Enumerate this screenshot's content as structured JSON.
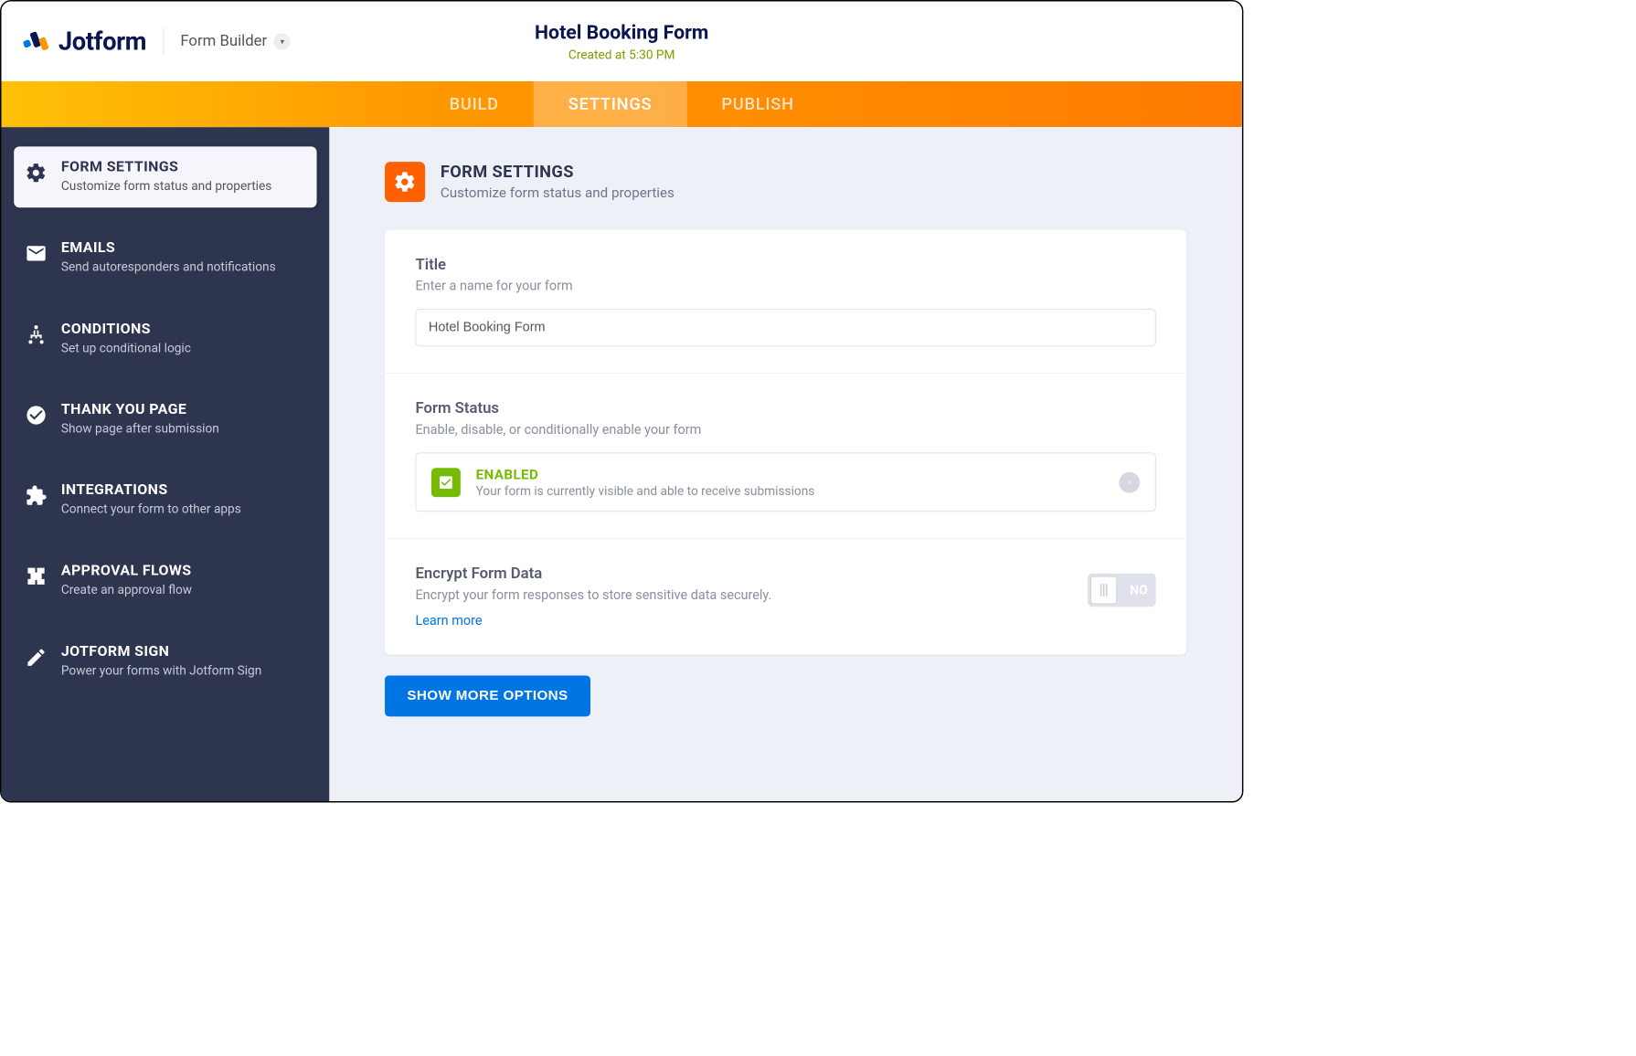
{
  "header": {
    "brand": "Jotform",
    "builder_label": "Form Builder",
    "form_title": "Hotel Booking Form",
    "form_meta": "Created at 5:30 PM"
  },
  "tabs": {
    "build": "BUILD",
    "settings": "SETTINGS",
    "publish": "PUBLISH"
  },
  "sidebar": {
    "items": [
      {
        "title": "FORM SETTINGS",
        "desc": "Customize form status and properties"
      },
      {
        "title": "EMAILS",
        "desc": "Send autoresponders and notifications"
      },
      {
        "title": "CONDITIONS",
        "desc": "Set up conditional logic"
      },
      {
        "title": "THANK YOU PAGE",
        "desc": "Show page after submission"
      },
      {
        "title": "INTEGRATIONS",
        "desc": "Connect your form to other apps"
      },
      {
        "title": "APPROVAL FLOWS",
        "desc": "Create an approval flow"
      },
      {
        "title": "JOTFORM SIGN",
        "desc": "Power your forms with Jotform Sign"
      }
    ]
  },
  "page": {
    "title": "FORM SETTINGS",
    "desc": "Customize form status and properties"
  },
  "title_section": {
    "label": "Title",
    "desc": "Enter a name for your form",
    "value": "Hotel Booking Form"
  },
  "status_section": {
    "label": "Form Status",
    "desc": "Enable, disable, or conditionally enable your form",
    "status_label": "ENABLED",
    "status_desc": "Your form is currently visible and able to receive submissions"
  },
  "encrypt_section": {
    "label": "Encrypt Form Data",
    "desc": "Encrypt your form responses to store sensitive data securely.",
    "learn_more": "Learn more",
    "toggle_label": "NO"
  },
  "more_button": "SHOW MORE OPTIONS"
}
